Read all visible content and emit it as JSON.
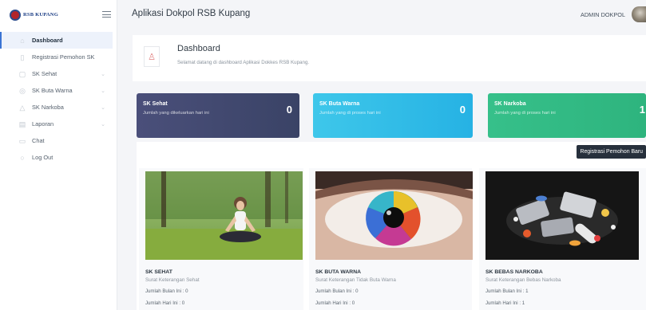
{
  "brand": {
    "text": "RSB KUPANG"
  },
  "header": {
    "app_title": "Aplikasi Dokpol RSB Kupang",
    "user_name": "ADMIN DOKPOL"
  },
  "sidebar": {
    "items": [
      {
        "label": "Dashboard",
        "icon": "home-icon",
        "active": true,
        "has_chevron": false
      },
      {
        "label": "Registrasi Pemohon SK",
        "icon": "file-icon",
        "active": false,
        "has_chevron": false
      },
      {
        "label": "SK Sehat",
        "icon": "heart-icon",
        "active": false,
        "has_chevron": true
      },
      {
        "label": "SK Buta Warna",
        "icon": "eye-icon",
        "active": false,
        "has_chevron": true
      },
      {
        "label": "SK Narkoba",
        "icon": "warning-icon",
        "active": false,
        "has_chevron": true
      },
      {
        "label": "Laporan",
        "icon": "report-icon",
        "active": false,
        "has_chevron": true
      },
      {
        "label": "Chat",
        "icon": "chat-icon",
        "active": false,
        "has_chevron": false
      },
      {
        "label": "Log Out",
        "icon": "logout-icon",
        "active": false,
        "has_chevron": false
      }
    ]
  },
  "page": {
    "title": "Dashboard",
    "subtitle": "Selamat datang di dashboard Aplikasi Dokkes RSB Kupang."
  },
  "stats": [
    {
      "title": "SK Sehat",
      "desc": "Jumlah yang dikeluarkan hari ini",
      "value": "0",
      "color": "#434a72"
    },
    {
      "title": "SK Buta Warna",
      "desc": "Jumlah yang di proses hari ini",
      "value": "0",
      "color": "#33bde8"
    },
    {
      "title": "SK Narkoba",
      "desc": "Jumlah yang di proses hari ini",
      "value": "1",
      "color": "#33ba85"
    }
  ],
  "actions": {
    "new_registration": "Registrasi Pemohon Baru"
  },
  "cards": [
    {
      "title": "SK SEHAT",
      "subtitle": "Surat Keterangan Sehat",
      "month": "Jumlah Bulan Ini : 0",
      "today": "Jumlah Hari Ini : 0",
      "image": "yoga-meditation-image"
    },
    {
      "title": "SK BUTA WARNA",
      "subtitle": "Surat Keterangan Tidak Buta Warna",
      "month": "Jumlah Bulan Ini : 0",
      "today": "Jumlah Hari Ini : 0",
      "image": "colorful-eye-image"
    },
    {
      "title": "SK BEBAS NARKOBA",
      "subtitle": "Surat Keterangan Bebas Narkoba",
      "month": "Jumlah Bulan Ini : 1",
      "today": "Jumlah Hari Ini : 1",
      "image": "pills-image"
    }
  ]
}
